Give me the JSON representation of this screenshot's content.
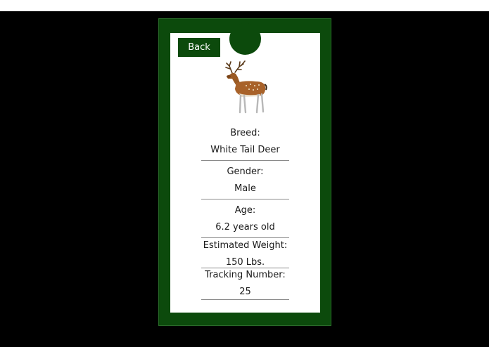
{
  "header": {
    "back_label": "Back"
  },
  "animal": {
    "image_icon": "deer-icon",
    "fields": [
      {
        "label": "Breed:",
        "value": "White Tail Deer"
      },
      {
        "label": "Gender:",
        "value": "Male"
      },
      {
        "label": "Age:",
        "value": "6.2 years old"
      },
      {
        "label": "Estimated Weight:",
        "value": "150 Lbs."
      },
      {
        "label": "Tracking Number:",
        "value": "25"
      }
    ]
  },
  "colors": {
    "frame_green": "#0c4a0c",
    "background": "#000000",
    "card": "#ffffff"
  }
}
